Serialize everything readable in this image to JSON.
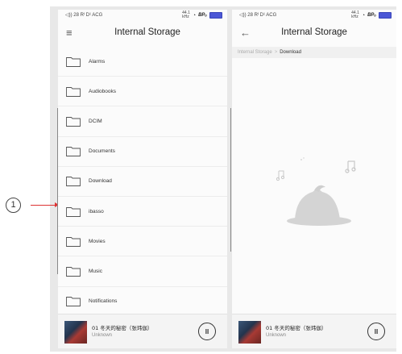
{
  "callout": {
    "number": "1"
  },
  "left_screen": {
    "status": {
      "left": "◁)) 28 Rᴵ D¹ ACG",
      "rate_top": "44.1",
      "rate_bottom": "kHz",
      "wifi": "wifi-icon",
      "bp": "BPₒ",
      "battery": "battery-icon"
    },
    "title": "Internal Storage",
    "nav_icon": "menu-icon",
    "folders": [
      {
        "label": "Alarms"
      },
      {
        "label": "Audiobooks"
      },
      {
        "label": "DCIM"
      },
      {
        "label": "Documents"
      },
      {
        "label": "Download"
      },
      {
        "label": "ibasso"
      },
      {
        "label": "Movies"
      },
      {
        "label": "Music"
      },
      {
        "label": "Notifications"
      }
    ]
  },
  "right_screen": {
    "status": {
      "left": "◁)) 28 Rᴵ D¹ ACG",
      "rate_top": "44.1",
      "rate_bottom": "kHz",
      "wifi": "wifi-icon",
      "bp": "BPₒ",
      "battery": "battery-icon"
    },
    "title": "Internal Storage",
    "nav_icon": "back-arrow-icon",
    "breadcrumb": {
      "root": "Internal Storage",
      "separator": ">",
      "current": "Download"
    }
  },
  "player": {
    "song": "01 冬天的秘密（张玮伽）",
    "artist": "Unknown",
    "button": "pause-icon",
    "pause_glyph": "II"
  },
  "colors": {
    "battery": "#4b57d6",
    "callout": "#dd3333",
    "empty_blob": "#d4d4d4"
  }
}
